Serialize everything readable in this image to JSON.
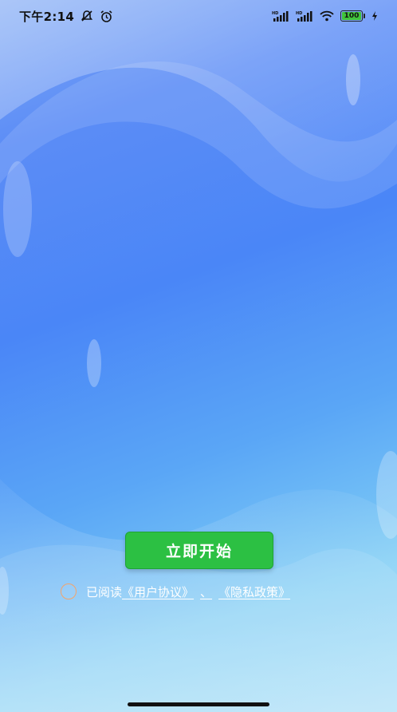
{
  "status_bar": {
    "time": "下午2:14",
    "battery": "100",
    "icons": [
      "mute-bell-icon",
      "alarm-clock-icon",
      "hd-signal-icon",
      "hd-signal-icon",
      "wifi-icon",
      "battery-icon",
      "charging-bolt-icon"
    ]
  },
  "main": {
    "start_button_label": "立即开始"
  },
  "agreement": {
    "prefix": "已阅读",
    "user_agreement_link": "《用户协议》",
    "separator": "、",
    "privacy_policy_link": "《隐私政策》",
    "checked": false
  },
  "colors": {
    "button_green": "#2cc043",
    "checkbox_border": "#f3a46b",
    "battery_fill": "#40c43a"
  }
}
